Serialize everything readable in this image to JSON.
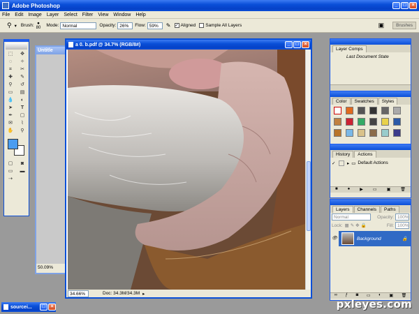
{
  "app": {
    "title": "Adobe Photoshop"
  },
  "menu": [
    "File",
    "Edit",
    "Image",
    "Layer",
    "Select",
    "Filter",
    "View",
    "Window",
    "Help"
  ],
  "options": {
    "brush_label": "Brush:",
    "brush_size": "80",
    "mode_label": "Mode:",
    "mode_value": "Normal",
    "opacity_label": "Opacity:",
    "opacity_value": "26%",
    "flow_label": "Flow:",
    "flow_value": "59%",
    "aligned_label": "Aligned",
    "sample_all_label": "Sample All Layers",
    "brushes_tab": "Brushes"
  },
  "documents": {
    "active_title": "a 0. b.pdf @ 34.7% (RGB/8#)",
    "active_zoom": "34.66%",
    "active_doc_info": "Doc: 34.3M/34.3M",
    "bg_title": "Untitle",
    "bg_zoom": "50.09%",
    "minimized_title": "sourcei..."
  },
  "panels": {
    "layer_comps": {
      "tab": "Layer Comps",
      "item": "Last Document State"
    },
    "styles": {
      "tabs": [
        "Color",
        "Swatches",
        "Styles"
      ]
    },
    "actions": {
      "tabs": [
        "History",
        "Actions"
      ],
      "item": "Default Actions"
    },
    "layers": {
      "tabs": [
        "Layers",
        "Channels",
        "Paths"
      ],
      "blend": "Normal",
      "opacity_label": "Opacity:",
      "opacity_value": "100%",
      "lock_label": "Lock:",
      "fill_label": "Fill:",
      "fill_value": "100%",
      "layer_name": "Background"
    }
  },
  "colors": {
    "xp_blue": "#0a4fd8",
    "chrome": "#ece9d8",
    "workspace": "#9a9a9a",
    "foreground": "#4a9cf0"
  },
  "watermark": "pxleyes.com"
}
